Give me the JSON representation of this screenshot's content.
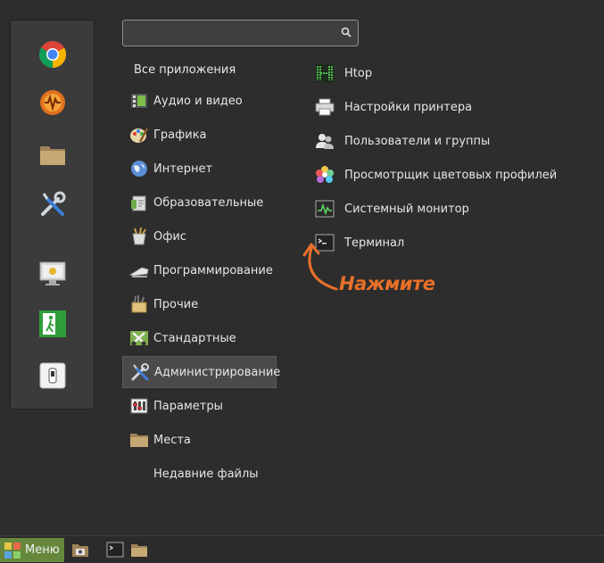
{
  "search": {
    "value": "",
    "placeholder": ""
  },
  "favorites": [
    {
      "name": "chrome-icon"
    },
    {
      "name": "audio-player-icon"
    },
    {
      "name": "folder-icon"
    },
    {
      "name": "tools-icon"
    },
    {
      "name": "lock-screen-icon"
    },
    {
      "name": "logout-icon"
    },
    {
      "name": "shutdown-icon"
    }
  ],
  "categories": [
    {
      "label": "Все приложения",
      "icon": ""
    },
    {
      "label": "Аудио и видео",
      "icon": "multimedia-icon"
    },
    {
      "label": "Графика",
      "icon": "graphics-icon"
    },
    {
      "label": "Интернет",
      "icon": "internet-icon"
    },
    {
      "label": "Образовательные",
      "icon": "education-icon"
    },
    {
      "label": "Офис",
      "icon": "office-icon"
    },
    {
      "label": "Программирование",
      "icon": "programming-icon"
    },
    {
      "label": "Прочие",
      "icon": "other-icon"
    },
    {
      "label": "Стандартные",
      "icon": "accessories-icon"
    },
    {
      "label": "Администрирование",
      "icon": "administration-icon",
      "selected": true
    },
    {
      "label": "Параметры",
      "icon": "settings-icon"
    },
    {
      "label": "Места",
      "icon": "places-folder-icon"
    },
    {
      "label": "Недавние файлы",
      "icon": ""
    }
  ],
  "apps": [
    {
      "label": "Htop",
      "icon": "htop-icon"
    },
    {
      "label": "Настройки принтера",
      "icon": "printer-icon"
    },
    {
      "label": "Пользователи и группы",
      "icon": "users-icon"
    },
    {
      "label": "Просмотрщик цветовых профилей",
      "icon": "color-profile-icon"
    },
    {
      "label": "Системный монитор",
      "icon": "system-monitor-icon"
    },
    {
      "label": "Терминал",
      "icon": "terminal-icon"
    }
  ],
  "annotation": {
    "text": "Нажмите",
    "color": "#e8702a"
  },
  "taskbar": {
    "menu_label": "Меню",
    "accent": "#66883c"
  }
}
